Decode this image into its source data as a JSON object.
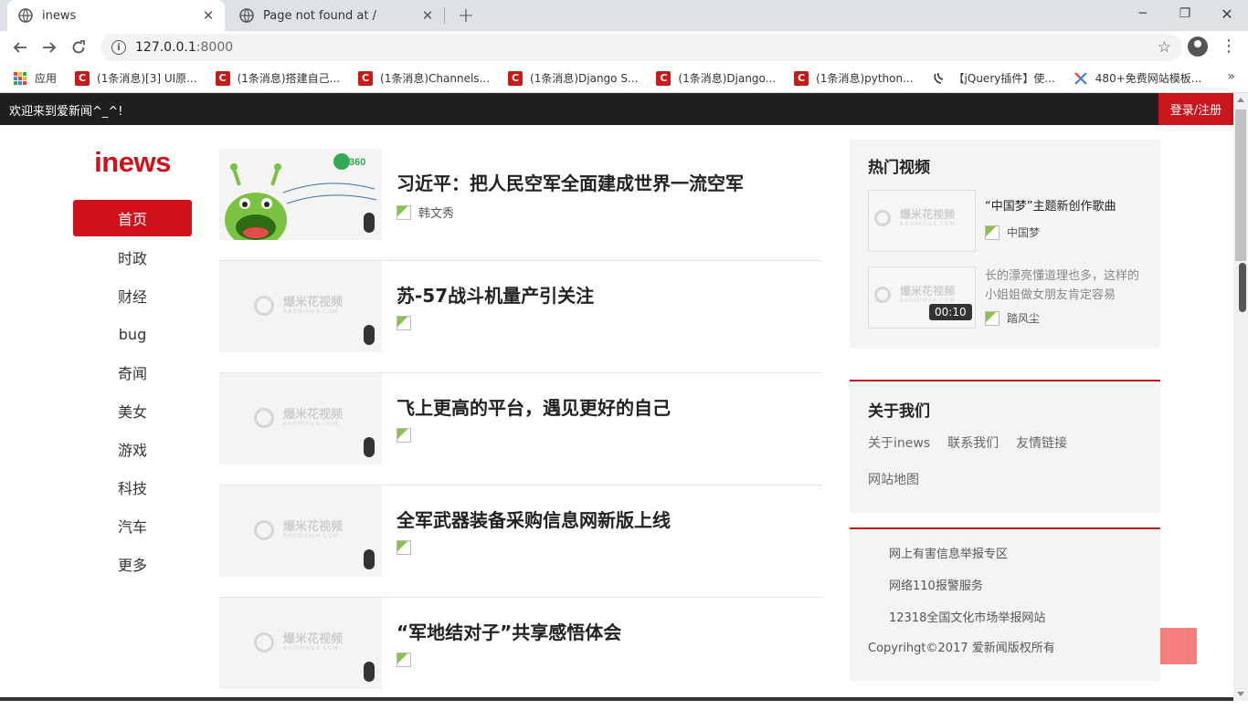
{
  "browser": {
    "tabs": [
      {
        "title": "inews",
        "active": true
      },
      {
        "title": "Page not found at /",
        "active": false
      }
    ],
    "url_host": "127.0.0.1",
    "url_port": ":8000",
    "bookmarks": [
      {
        "label": "应用",
        "icon": "apps-grid-icon"
      },
      {
        "label": "(1条消息)[3] UI原...",
        "icon": "csdn-icon"
      },
      {
        "label": "(1条消息)搭建自己...",
        "icon": "csdn-icon"
      },
      {
        "label": "(1条消息)Channels...",
        "icon": "csdn-icon"
      },
      {
        "label": "(1条消息)Django S...",
        "icon": "csdn-icon"
      },
      {
        "label": "(1条消息)Django...",
        "icon": "csdn-icon"
      },
      {
        "label": "(1条消息)python...",
        "icon": "csdn-icon"
      },
      {
        "label": "【jQuery插件】使...",
        "icon": "jquery-icon"
      },
      {
        "label": "480+免费网站模板...",
        "icon": "template-icon"
      }
    ],
    "bookmarks_more": "»"
  },
  "site": {
    "welcome": "欢迎来到爱新闻^_^!",
    "login": "登录/注册",
    "logo": "inews",
    "nav": [
      "首页",
      "时政",
      "财经",
      "bug",
      "奇闻",
      "美女",
      "游戏",
      "科技",
      "汽车",
      "更多"
    ],
    "news": [
      {
        "title": "习近平：把人民空军全面建成世界一流空军",
        "author": "韩文秀"
      },
      {
        "title": "苏-57战斗机量产引关注",
        "author": ""
      },
      {
        "title": "飞上更高的平台，遇见更好的自己",
        "author": ""
      },
      {
        "title": "全军武器装备采购信息网新版上线",
        "author": ""
      },
      {
        "title": "“军地结对子”共享感悟体会",
        "author": ""
      }
    ],
    "placeholder_brand": "爆米花视频",
    "placeholder_sub": "BAOMIHUA.COM",
    "hot_videos": {
      "heading": "热门视频",
      "items": [
        {
          "title": "“中国梦”主题新创作歌曲",
          "author": "中国梦",
          "duration": ""
        },
        {
          "title": "长的漂亮懂道理也多，这样的小姐姐做女朋友肯定容易",
          "author": "踏风尘",
          "duration": "00:10"
        }
      ]
    },
    "about": {
      "heading": "关于我们",
      "links": [
        "关于inews",
        "联系我们",
        "友情链接",
        "网站地图"
      ]
    },
    "reports": [
      "网上有害信息举报专区",
      "网络110报警服务",
      "12318全国文化市场举报网站"
    ],
    "copyright": "Copyrihgt©2017 爱新闻版权所有"
  },
  "colors": {
    "accent": "#d0111b",
    "topbar": "#1f1f1f",
    "back_to_top": "#f36f6f"
  }
}
